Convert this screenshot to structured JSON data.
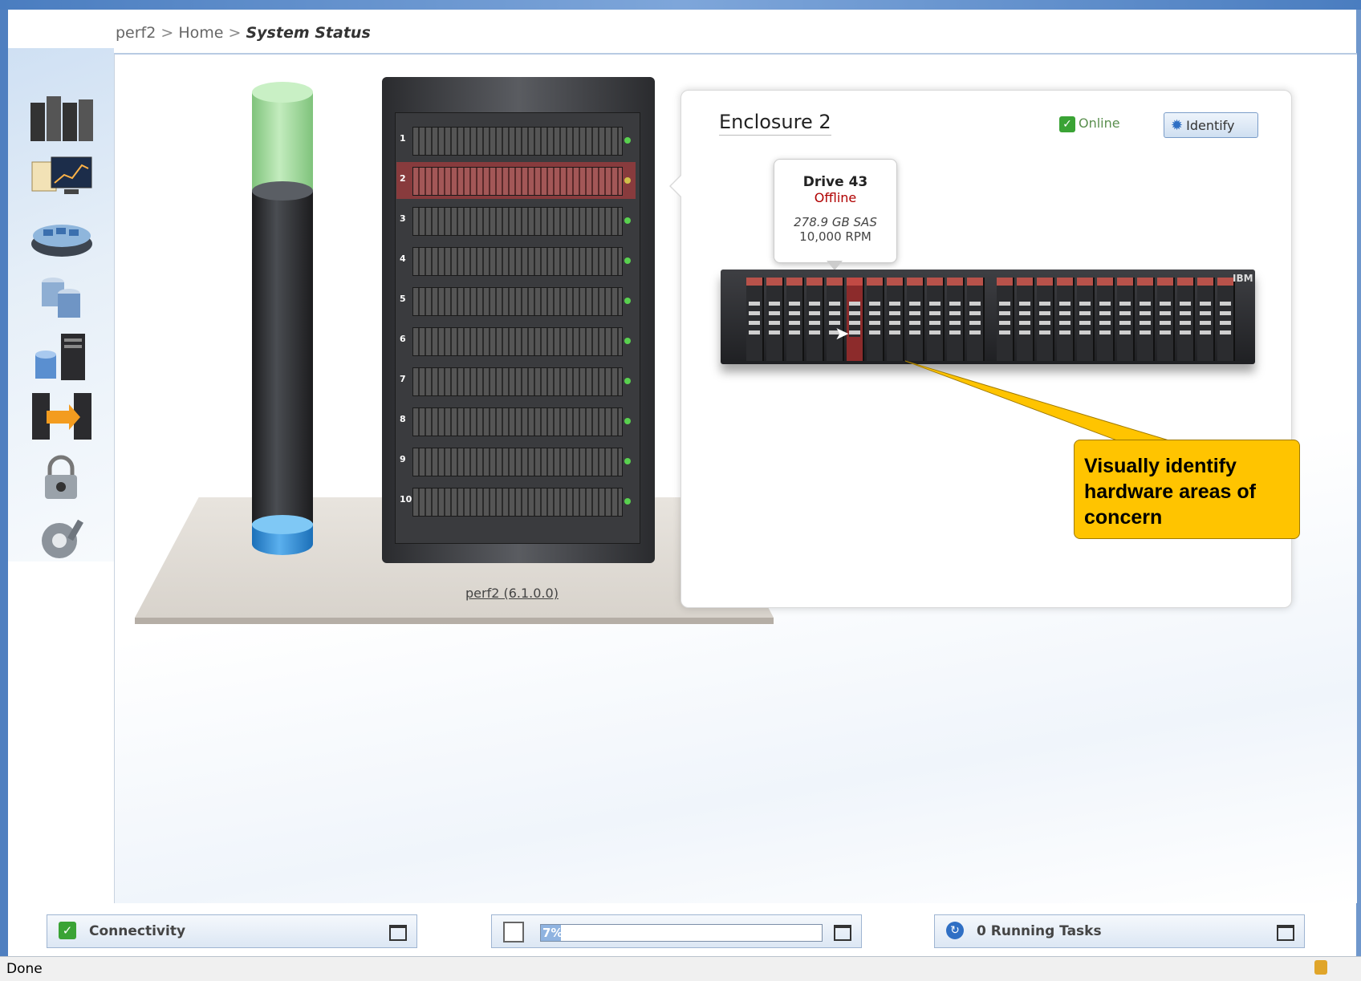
{
  "breadcrumb": {
    "system": "perf2",
    "sep1": ">",
    "home": "Home",
    "sep2": ">",
    "current": "System Status"
  },
  "nav": {
    "icons": [
      "monitoring-icon",
      "performance-icon",
      "pools-icon",
      "volumes-icon",
      "hosts-icon",
      "copy-services-icon",
      "access-icon",
      "settings-icon"
    ]
  },
  "system": {
    "label": "perf2 (6.1.0.0)",
    "rows": [
      "1",
      "2",
      "3",
      "4",
      "5",
      "6",
      "7",
      "8",
      "9",
      "10"
    ],
    "selected_row": "2"
  },
  "enclosure": {
    "title": "Enclosure 2",
    "status": "Online",
    "identify_label": "Identify",
    "logo": "IBM",
    "selected_drive_index": 5,
    "drive_count": 24
  },
  "tooltip": {
    "drive": "Drive 43",
    "state": "Offline",
    "capacity": "278.9 GB SAS",
    "speed": "10,000 RPM"
  },
  "callout": {
    "text": "Visually identify hardware areas of concern"
  },
  "bottom": {
    "connectivity_label": "Connectivity",
    "progress_text": "7%",
    "progress_value": 0.07,
    "tasks_label": "0 Running Tasks"
  },
  "statusbar": {
    "text": "Done"
  },
  "colors": {
    "accent": "#4a7dc0",
    "callout": "#ffc400",
    "offline": "#b00000",
    "online": "#3aa335"
  }
}
